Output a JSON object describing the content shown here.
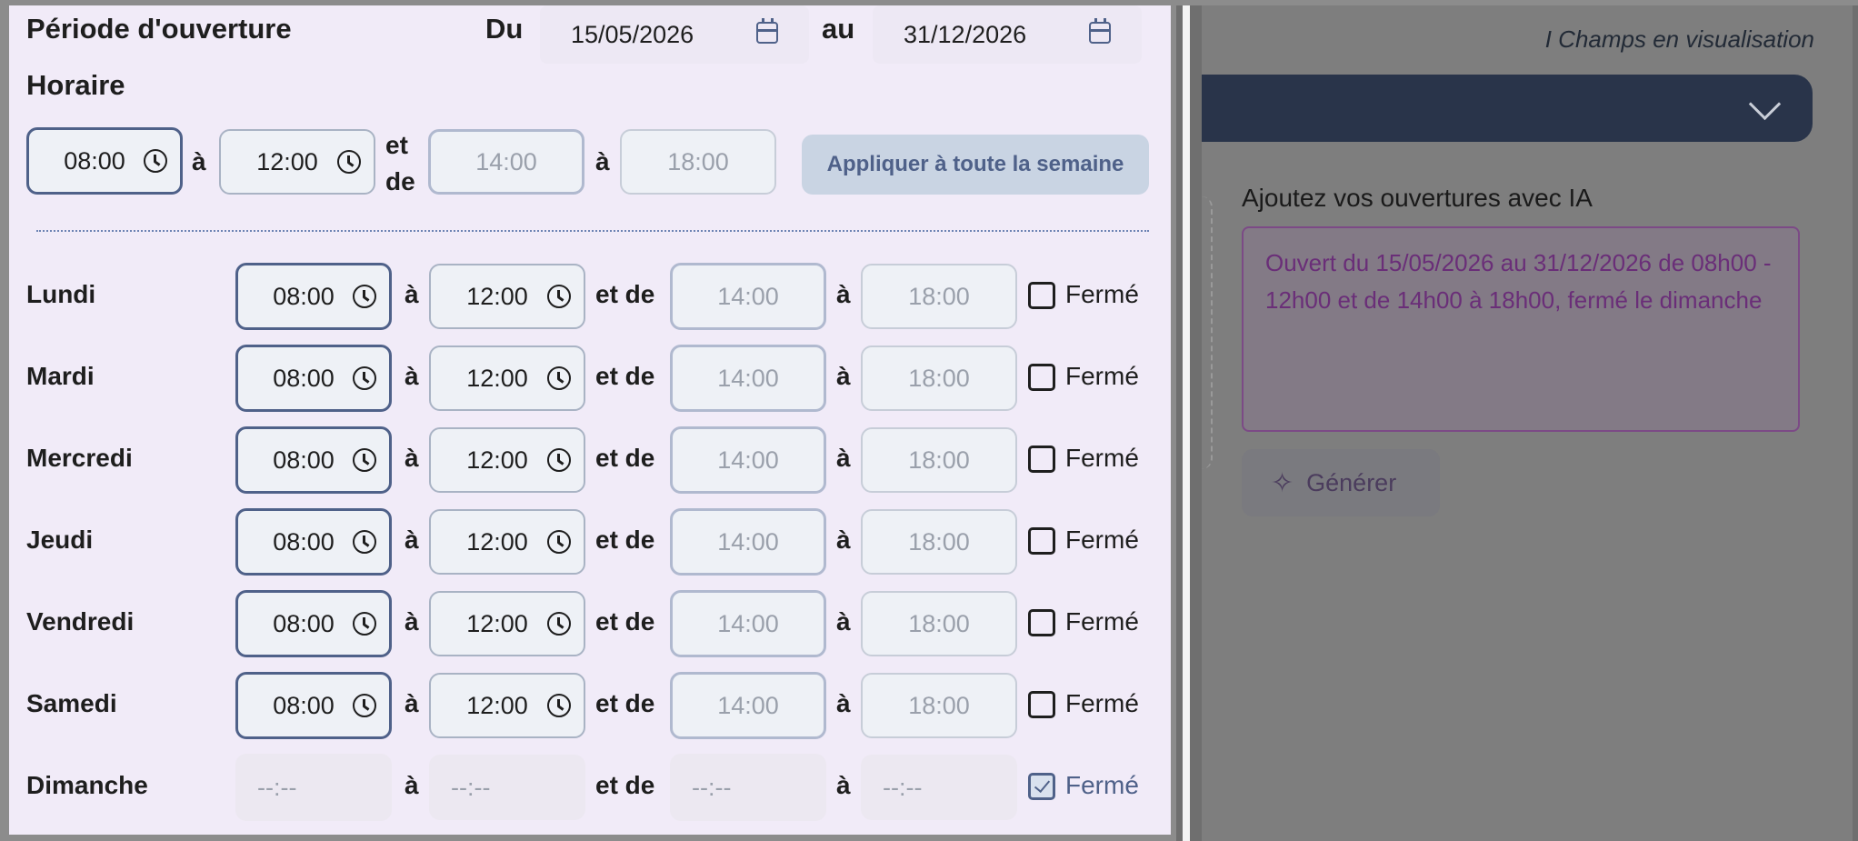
{
  "periode": {
    "title": "Période d'ouverture",
    "du_label": "Du",
    "du_value": "15/05/2026",
    "au_label": "au",
    "au_value": "31/12/2026"
  },
  "horaire": {
    "title": "Horaire",
    "start1": "08:00",
    "a1": "à",
    "end1": "12:00",
    "et_de_line1": "et",
    "et_de_line2": "de",
    "start2": "14:00",
    "a2": "à",
    "end2": "18:00",
    "apply_label": "Appliquer à toute la semaine"
  },
  "days": [
    {
      "name": "Lundi",
      "s1": "08:00",
      "a1": "à",
      "e1": "12:00",
      "etde": "et de",
      "s2": "14:00",
      "a2": "à",
      "e2": "18:00",
      "ferme": "Fermé",
      "closed": false
    },
    {
      "name": "Mardi",
      "s1": "08:00",
      "a1": "à",
      "e1": "12:00",
      "etde": "et de",
      "s2": "14:00",
      "a2": "à",
      "e2": "18:00",
      "ferme": "Fermé",
      "closed": false
    },
    {
      "name": "Mercredi",
      "s1": "08:00",
      "a1": "à",
      "e1": "12:00",
      "etde": "et de",
      "s2": "14:00",
      "a2": "à",
      "e2": "18:00",
      "ferme": "Fermé",
      "closed": false
    },
    {
      "name": "Jeudi",
      "s1": "08:00",
      "a1": "à",
      "e1": "12:00",
      "etde": "et de",
      "s2": "14:00",
      "a2": "à",
      "e2": "18:00",
      "ferme": "Fermé",
      "closed": false
    },
    {
      "name": "Vendredi",
      "s1": "08:00",
      "a1": "à",
      "e1": "12:00",
      "etde": "et de",
      "s2": "14:00",
      "a2": "à",
      "e2": "18:00",
      "ferme": "Fermé",
      "closed": false
    },
    {
      "name": "Samedi",
      "s1": "08:00",
      "a1": "à",
      "e1": "12:00",
      "etde": "et de",
      "s2": "14:00",
      "a2": "à",
      "e2": "18:00",
      "ferme": "Fermé",
      "closed": false
    },
    {
      "name": "Dimanche",
      "s1": "--:--",
      "a1": "à",
      "e1": "--:--",
      "etde": "et de",
      "s2": "--:--",
      "a2": "à",
      "e2": "--:--",
      "ferme": "Fermé",
      "closed": true
    }
  ],
  "right": {
    "legend_visualisation": "I Champs en visualisation",
    "ia_label": "Ajoutez vos ouvertures avec IA",
    "ia_text": "Ouvert du 15/05/2026 au 31/12/2026 de 08h00 - 12h00 et de 14h00 à 18h00, fermé le dimanche",
    "generate_label": "Générer"
  },
  "icons": {
    "calendar": "calendar-icon",
    "clock": "clock-icon",
    "chevron": "chevron-down-icon",
    "sparkle": "sparkle-icon"
  },
  "colors": {
    "panel_bg": "#f1ebf8",
    "accent": "#4f6189",
    "dark_bar": "#29344a",
    "ia_text": "#6a2e78"
  }
}
